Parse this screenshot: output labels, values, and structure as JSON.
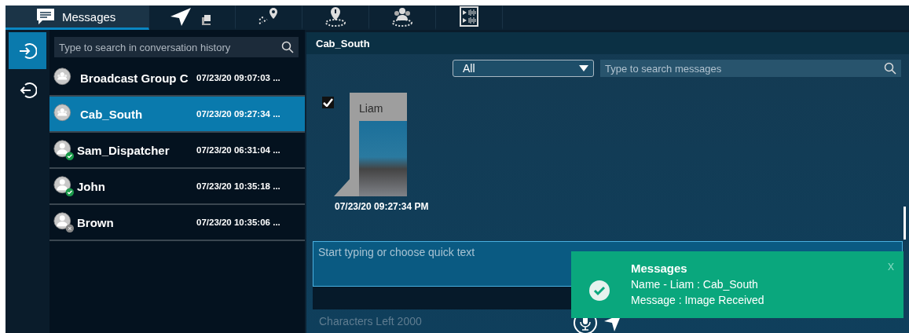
{
  "tabs": [
    {
      "label": "Messages",
      "selected": true
    },
    {
      "selected": false
    },
    {
      "selected": false
    },
    {
      "selected": false
    },
    {
      "selected": false
    },
    {
      "selected": false
    }
  ],
  "rail": [
    {
      "selected": true
    },
    {
      "selected": false
    }
  ],
  "conversation_search": {
    "placeholder": "Type to search in conversation history"
  },
  "conversations": [
    {
      "name": "Broadcast Group C",
      "time": "07/23/20 09:07:03 ...",
      "kind": "group",
      "selected": false
    },
    {
      "name": "Cab_South",
      "time": "07/23/20 09:27:34 ...",
      "kind": "group",
      "selected": true
    },
    {
      "name": "Sam_Dispatcher",
      "time": "07/23/20 06:31:04 ...",
      "kind": "online",
      "selected": false
    },
    {
      "name": "John",
      "time": "07/23/20 10:35:18 ...",
      "kind": "online",
      "selected": false
    },
    {
      "name": "Brown",
      "time": "07/23/20 10:35:06 ...",
      "kind": "offline",
      "selected": false
    }
  ],
  "chat": {
    "title": "Cab_South",
    "filter": "All",
    "search": {
      "placeholder": "Type to search messages"
    },
    "messages": [
      {
        "sender": "Liam",
        "checked": true,
        "time": "07/23/20 09:27:34 PM"
      }
    ],
    "composer": {
      "placeholder": "Start typing or choose quick text"
    },
    "characters_left": "Characters Left 2000"
  },
  "toast": {
    "title": "Messages",
    "lines": [
      "Name - Liam : Cab_South",
      "Message : Image Received"
    ],
    "close": "x"
  }
}
